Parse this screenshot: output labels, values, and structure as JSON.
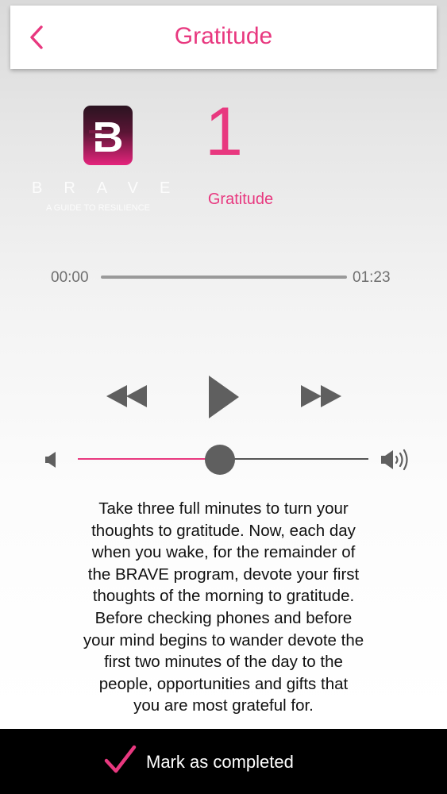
{
  "header": {
    "title": "Gratitude",
    "back_icon": "chevron-left-icon"
  },
  "logo": {
    "monogram": "B",
    "word": "BRAVE",
    "tagline": "A GUIDE TO RESILIENCE"
  },
  "session": {
    "day_number": "1",
    "day_label": "Gratitude"
  },
  "player": {
    "elapsed": "00:00",
    "duration": "01:23",
    "progress": 0,
    "volume": 0.49,
    "rewind_icon": "rewind-icon",
    "play_icon": "play-icon",
    "forward_icon": "fast-forward-icon",
    "volume_low_icon": "speaker-low-icon",
    "volume_high_icon": "speaker-high-icon"
  },
  "description": {
    "lines": [
      "Take three full minutes to turn your",
      "thoughts to gratitude. Now, each day",
      "when you wake, for the remainder of",
      "the BRAVE program, devote your first",
      "thoughts of the morning to gratitude.",
      "Before checking phones and before",
      "your mind begins to wander devote the",
      "first two minutes of the day to the",
      "people, opportunities and gifts that",
      "you are most grateful for."
    ]
  },
  "footer": {
    "label": "Mark as completed",
    "icon": "checkmark-icon"
  },
  "colors": {
    "accent": "#e8387f",
    "control_gray": "#5f5f5f",
    "footer_bg": "#000000"
  }
}
